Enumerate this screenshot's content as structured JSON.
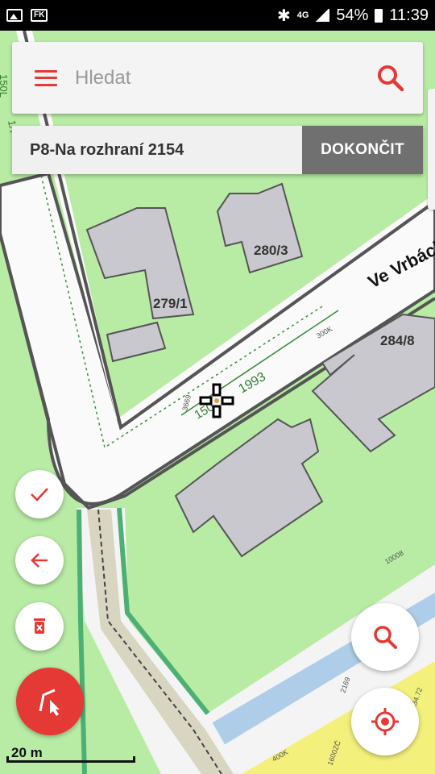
{
  "status_bar": {
    "left_icons": [
      "image-icon",
      "fk-icon"
    ],
    "fk_label": "FK",
    "network_label": "4G",
    "battery_percent": "54%",
    "time": "11:39"
  },
  "search": {
    "placeholder": "Hledat"
  },
  "task": {
    "title": "P8-Na rozhraní 2154",
    "finish_label": "DOKONČIT"
  },
  "map": {
    "street_name": "Ve Vrbách",
    "parcel_labels": [
      "279/1",
      "280/3",
      "284/8"
    ],
    "measure_label": "1993",
    "small_labels": [
      "150L",
      "1/7",
      "3669",
      "150",
      "300K",
      "10008",
      "2169",
      "1600ZČ",
      "400K",
      "234.72"
    ],
    "colors": {
      "land": "#b8eca4",
      "road": "#fafafa",
      "building": "#c8c8ce",
      "path": "#d8d6c0",
      "water": "#aecde8",
      "yellow_zone": "#f4f07c",
      "green_line": "#4caf74"
    }
  },
  "buttons": {
    "confirm_icon": "check-icon",
    "back_icon": "arrow-left-icon",
    "delete_icon": "trash-icon",
    "zoom_icon": "magnifier-icon",
    "locate_icon": "gps-target-icon",
    "draw_icon": "draw-line-icon"
  },
  "scale": {
    "label": "20 m"
  },
  "accent_color": "#e53935"
}
